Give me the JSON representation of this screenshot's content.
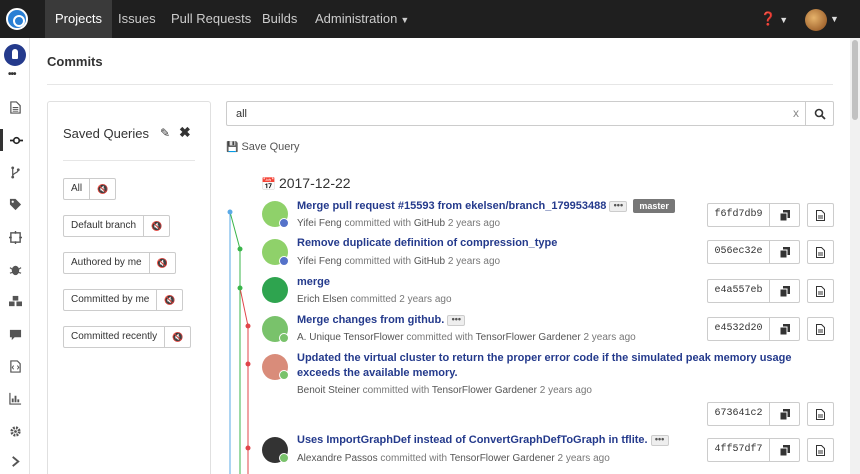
{
  "nav": {
    "items": [
      "Projects",
      "Issues",
      "Pull Requests",
      "Builds",
      "Administration"
    ],
    "active": "Projects",
    "help_icon": "question-circle-icon"
  },
  "sidebar": {
    "more": "•••",
    "icons": [
      "file-icon",
      "commit-icon",
      "branch-icon",
      "tag-icon",
      "pull-request-icon",
      "bug-icon",
      "cubes-icon",
      "comments-icon",
      "code-icon",
      "chart-icon",
      "gear-icon",
      "chevron-right-icon"
    ],
    "active_icon": "commit-icon"
  },
  "page": {
    "title": "Commits"
  },
  "saved_queries": {
    "title": "Saved Queries",
    "items": [
      "All",
      "Default branch",
      "Authored by me",
      "Committed by me",
      "Committed recently"
    ]
  },
  "search": {
    "value": "all",
    "clear": "x"
  },
  "save_query_label": "Save Query",
  "date_group": "2017-12-22",
  "commits": [
    {
      "title": "Merge pull request #15593 from ekelsen/branch_179953488",
      "ellipsis": "•••",
      "branch": "master",
      "author": "Yifei Feng",
      "verb": "committed with",
      "committer": "GitHub",
      "when": "2 years ago",
      "hash": "f6fd7db9",
      "avatar_color": "#8fd16a"
    },
    {
      "title": "Remove duplicate definition of compression_type",
      "author": "Yifei Feng",
      "verb": "committed with",
      "committer": "GitHub",
      "when": "2 years ago",
      "hash": "056ec32e",
      "avatar_color": "#8fd16a"
    },
    {
      "title": "merge",
      "author": "Erich Elsen",
      "verb": "committed",
      "committer": "",
      "when": "2 years ago",
      "hash": "e4a557eb",
      "avatar_color": "#2ea44f"
    },
    {
      "title": "Merge changes from github.",
      "ellipsis": "•••",
      "author": "A. Unique TensorFlower",
      "verb": "committed with",
      "committer": "TensorFlower Gardener",
      "when": "2 years ago",
      "hash": "e4532d20",
      "avatar_color": "#79c26b"
    },
    {
      "title": "Updated the virtual cluster to return the proper error code if the simulated peak memory usage exceeds the available memory.",
      "author": "Benoit Steiner",
      "verb": "committed with",
      "committer": "TensorFlower Gardener",
      "when": "2 years ago",
      "hash": "673641c2",
      "avatar_color": "#d98c7a"
    },
    {
      "title": "Uses ImportGraphDef instead of ConvertGraphDefToGraph in tflite.",
      "ellipsis": "•••",
      "author": "Alexandre Passos",
      "verb": "committed with",
      "committer": "TensorFlower Gardener",
      "when": "2 years ago",
      "hash": "4ff57df7",
      "avatar_color": "#333333"
    }
  ],
  "colors": {
    "nav_bg": "#1f1f1f",
    "link": "#243a8c",
    "graph_blue": "#5aa9e6",
    "graph_green": "#3ab54a",
    "graph_red": "#e0454a"
  }
}
